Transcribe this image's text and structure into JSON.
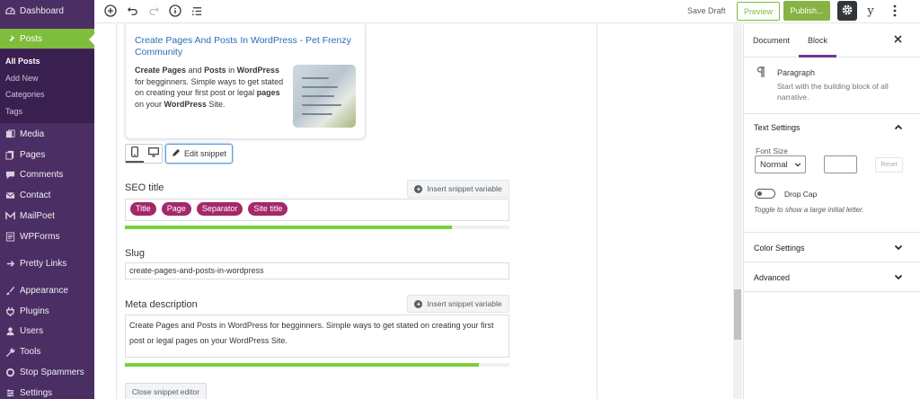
{
  "admin_menu": {
    "items": [
      {
        "label": "Dashboard",
        "icon": "dashboard-icon"
      },
      {
        "label": "Posts",
        "icon": "pin-icon"
      },
      {
        "label": "Media",
        "icon": "media-icon"
      },
      {
        "label": "Pages",
        "icon": "pages-icon"
      },
      {
        "label": "Comments",
        "icon": "comments-icon"
      },
      {
        "label": "Contact",
        "icon": "mail-icon"
      },
      {
        "label": "MailPoet",
        "icon": "mailpoet-icon"
      },
      {
        "label": "WPForms",
        "icon": "wpforms-icon"
      },
      {
        "label": "Pretty Links",
        "icon": "link-icon"
      },
      {
        "label": "Appearance",
        "icon": "brush-icon"
      },
      {
        "label": "Plugins",
        "icon": "plug-icon"
      },
      {
        "label": "Users",
        "icon": "users-icon"
      },
      {
        "label": "Tools",
        "icon": "wrench-icon"
      },
      {
        "label": "Stop Spammers",
        "icon": "stop-icon"
      },
      {
        "label": "Settings",
        "icon": "settings-icon"
      }
    ],
    "submenu": [
      "All Posts",
      "Add New",
      "Categories",
      "Tags"
    ],
    "colors": {
      "background": "#4b2e63",
      "current": "#7fbd3c"
    }
  },
  "toolbar": {
    "save_draft": "Save Draft",
    "preview": "Preview",
    "publish": "Publish...",
    "yoast": "y"
  },
  "snippet_preview": {
    "title": "Create Pages And Posts In WordPress - Pet Frenzy Community",
    "description_html": "<b>Create Pages</b> and <b>Posts</b> in <b>WordPress</b> for begginners. Simple ways to get stated on creating your first post or legal <b>pages</b> on your <b>WordPress</b> Site."
  },
  "edit_snippet": "Edit snippet",
  "seo_title": {
    "label": "SEO title",
    "insert_variable": "Insert snippet variable",
    "pills": [
      "Title",
      "Page",
      "Separator",
      "Site title"
    ],
    "progress": 0.85
  },
  "slug": {
    "label": "Slug",
    "value": "create-pages-and-posts-in-wordpress"
  },
  "meta_description": {
    "label": "Meta description",
    "insert_variable": "Insert snippet variable",
    "value": "Create Pages and Posts in WordPress for begginners. Simple ways to get stated on creating your first post or legal pages on your WordPress Site.",
    "progress": 0.92
  },
  "close_snippet_editor": "Close snippet editor",
  "sidebar": {
    "tabs": [
      "Document",
      "Block"
    ],
    "active_tab": "Block",
    "block_name": "Paragraph",
    "block_desc": "Start with the building block of all narrative.",
    "text_settings": "Text Settings",
    "font_size_label": "Font Size",
    "font_size_value": "Normal",
    "reset": "Reset",
    "drop_cap": "Drop Cap",
    "drop_cap_help": "Toggle to show a large initial letter.",
    "color_settings": "Color Settings",
    "advanced": "Advanced",
    "accent": "#6c3990"
  }
}
